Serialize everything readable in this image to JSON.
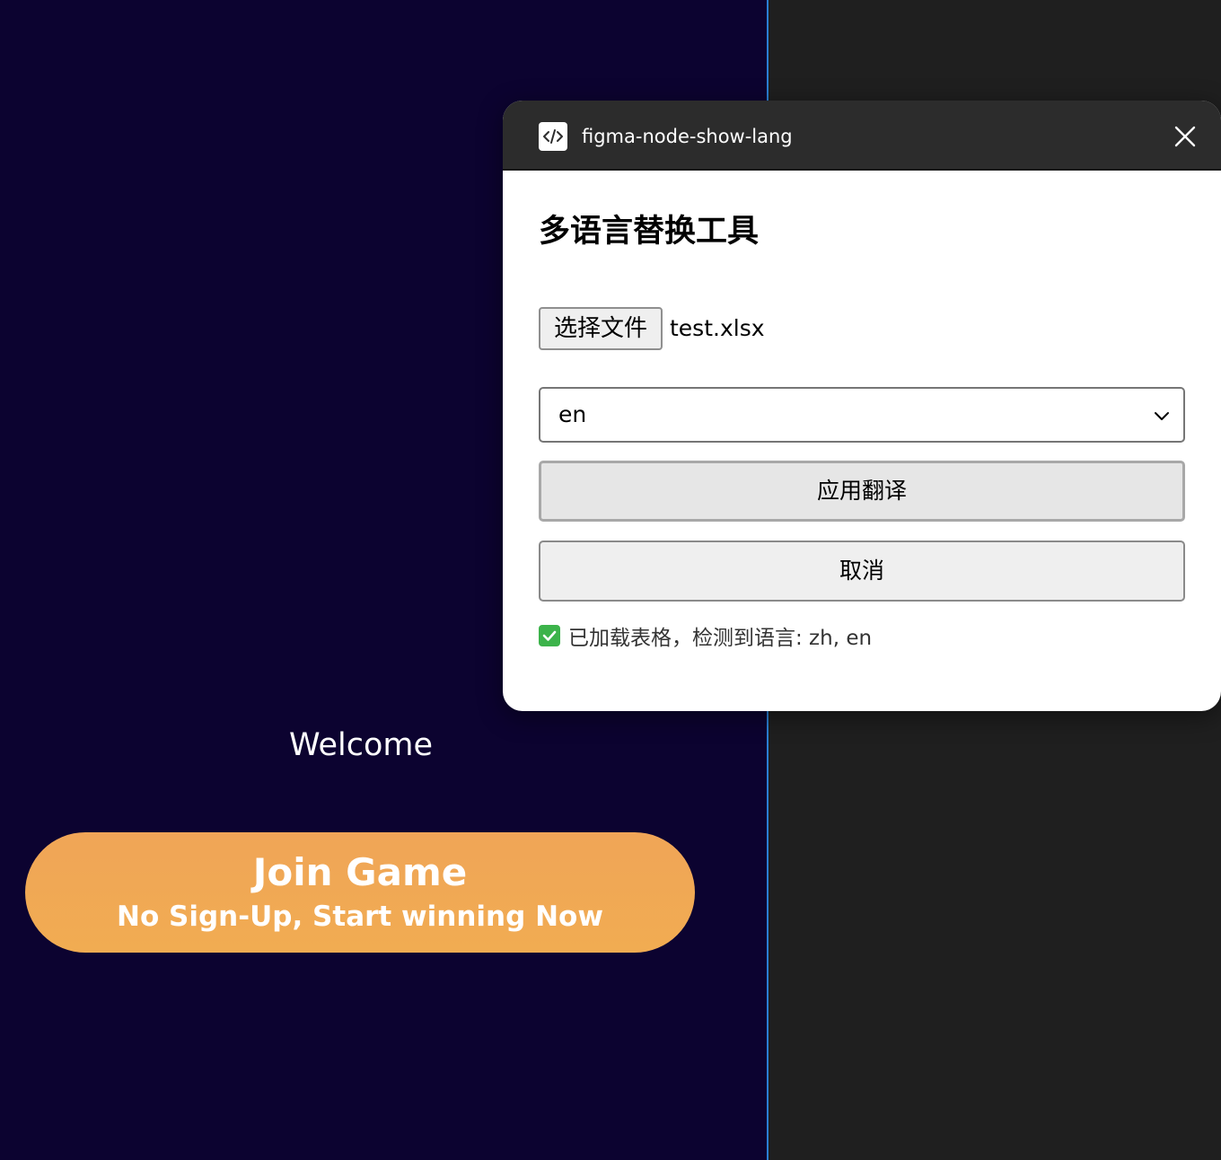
{
  "canvas": {
    "frame": {
      "welcome_text": "Welcome",
      "join_button": {
        "title": "Join Game",
        "subtitle": "No Sign-Up, Start winning Now"
      }
    }
  },
  "plugin": {
    "title": "figma-node-show-lang",
    "icon": "code-icon",
    "heading": "多语言替换工具",
    "file_button_label": "选择文件",
    "file_name": "test.xlsx",
    "language_select": {
      "selected": "en"
    },
    "apply_label": "应用翻译",
    "cancel_label": "取消",
    "status_text": "已加载表格，检测到语言: zh, en"
  },
  "colors": {
    "frame_bg": "#0c0330",
    "canvas_bg": "#1f1f1f",
    "join_button": "#f0a557",
    "titlebar": "#2c2c2c",
    "status_check": "#3cb34a"
  }
}
